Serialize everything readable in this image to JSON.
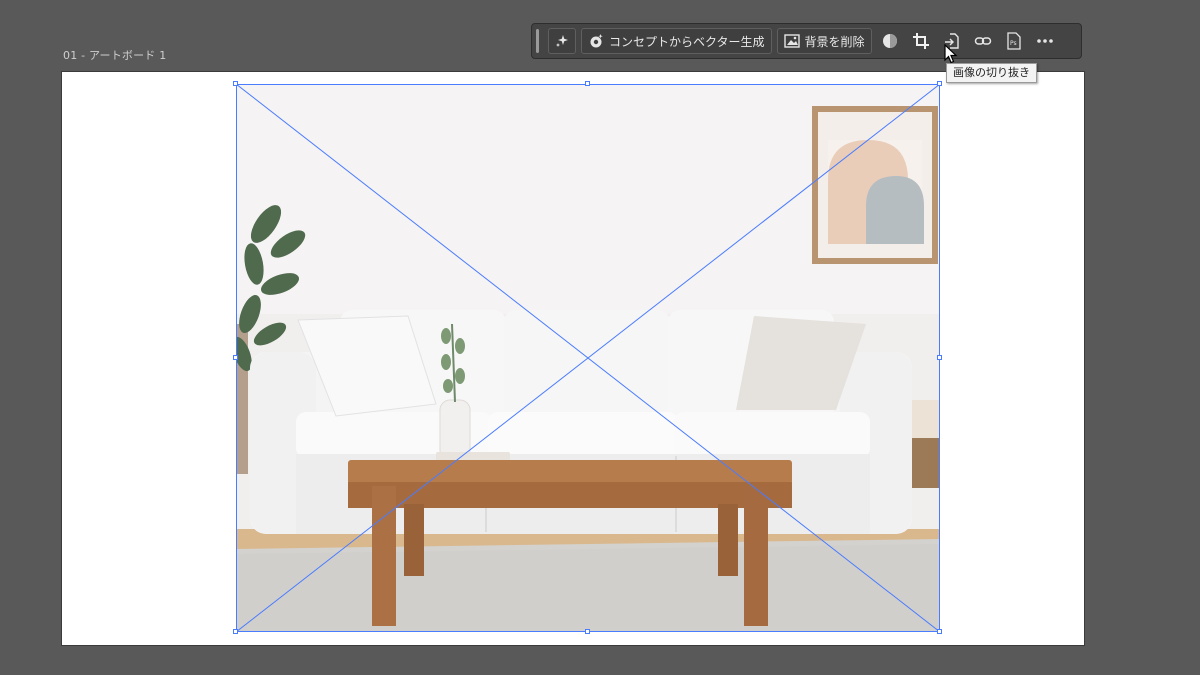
{
  "artboard": {
    "label": "01 - アートボード 1"
  },
  "toolbar": {
    "generate_vector_label": "コンセプトからベクター生成",
    "remove_background_label": "背景を削除",
    "tooltip": "画像の切り抜き"
  },
  "icons": {
    "sparkle": "sparkle-icon",
    "generate": "generative-icon",
    "image": "image-icon",
    "mask": "mask-icon",
    "crop": "crop-icon",
    "embed": "embed-icon",
    "link": "link-icon",
    "photoshop": "ps-icon",
    "more": "more-icon"
  },
  "colors": {
    "canvas": "#595959",
    "selection": "#4a7cff",
    "toolbar_bg": "#444444"
  }
}
